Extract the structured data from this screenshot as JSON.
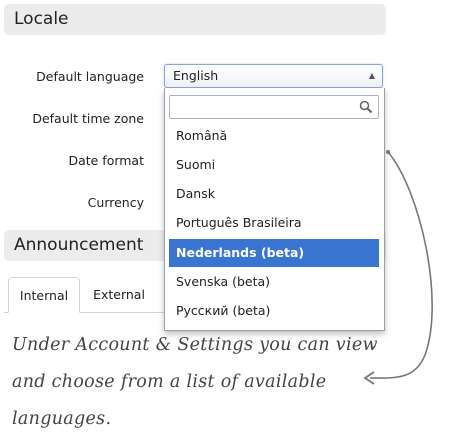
{
  "locale": {
    "header": "Locale",
    "labels": {
      "default_language": "Default language",
      "default_time_zone": "Default time zone",
      "date_format": "Date format",
      "currency": "Currency"
    },
    "language_select": {
      "value": "English",
      "search_placeholder": "",
      "options": [
        {
          "label": "Română"
        },
        {
          "label": "Suomi"
        },
        {
          "label": "Dansk"
        },
        {
          "label": "Português Brasileira"
        },
        {
          "label": "Nederlands (beta)",
          "selected": true
        },
        {
          "label": "Svenska (beta)"
        },
        {
          "label": "Русский (beta)"
        }
      ]
    }
  },
  "announcement": {
    "header": "Announcement",
    "tabs": [
      {
        "label": "Internal",
        "active": true
      },
      {
        "label": "External",
        "active": false
      }
    ]
  },
  "annotation": {
    "text": "Under Account & Settings you can view and choose from a list of available languages."
  },
  "colors": {
    "highlight": "#3a75d2",
    "header_bg": "#ececec",
    "arrow": "#777777"
  }
}
